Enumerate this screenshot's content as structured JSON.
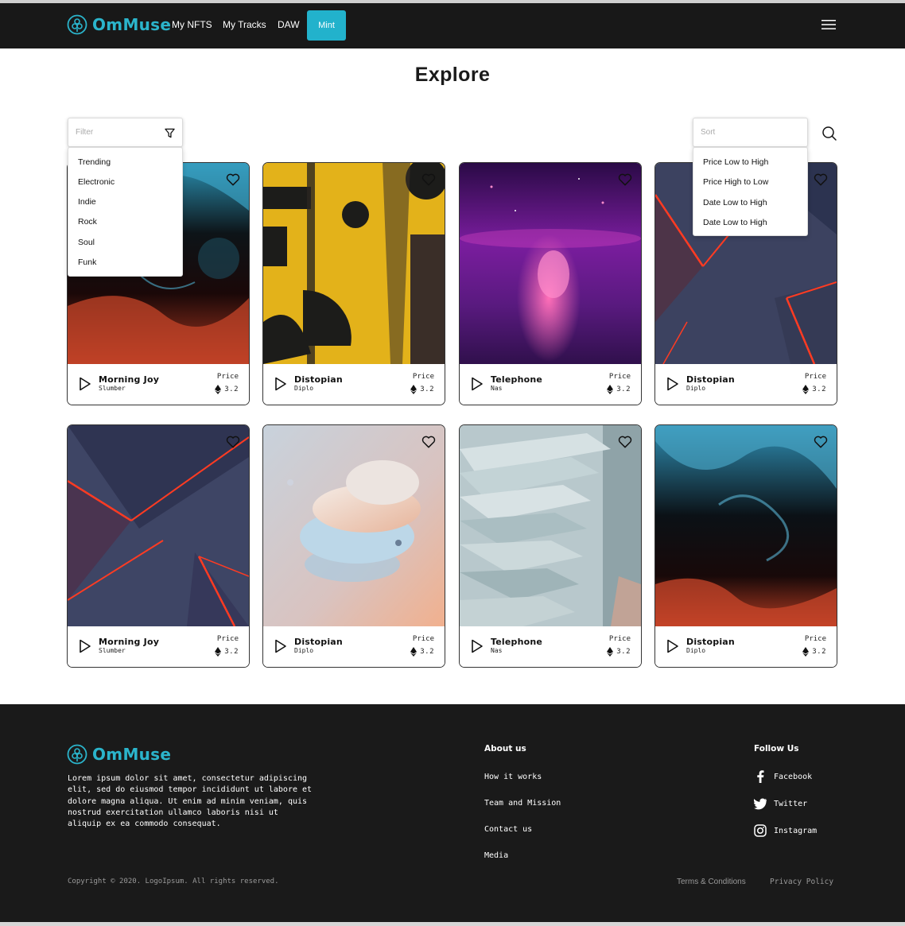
{
  "brand": {
    "name": "OmMuse",
    "accent": "#22b2cc",
    "dark": "#181818"
  },
  "nav": {
    "links": [
      "My NFTS",
      "My Tracks",
      "DAW"
    ],
    "mint": "Mint",
    "menu_icon": "hamburger-icon"
  },
  "page_title": "Explore",
  "filter": {
    "placeholder": "Filter",
    "icon": "filter-icon",
    "options": [
      "Trending",
      "Electronic",
      "Indie",
      "Rock",
      "Soul",
      "Funk"
    ]
  },
  "sort": {
    "placeholder": "Sort",
    "options": [
      "Price Low to High",
      "Price High to Low",
      "Date Low to High",
      "Date Low to High"
    ]
  },
  "search_icon": "search-icon",
  "cards": [
    {
      "title": "Morning Joy",
      "artist": "Slumber",
      "price_label": "Price",
      "price": "3.2",
      "art": "fluid-red-blue"
    },
    {
      "title": "Distopian",
      "artist": "Diplo",
      "price_label": "Price",
      "price": "3.2",
      "art": "yellow-grunge"
    },
    {
      "title": "Telephone",
      "artist": "Nas",
      "price_label": "Price",
      "price": "3.2",
      "art": "purple-galaxy"
    },
    {
      "title": "Distopian",
      "artist": "Diplo",
      "price_label": "Price",
      "price": "3.2",
      "art": "red-neon-facets"
    },
    {
      "title": "Morning Joy",
      "artist": "Slumber",
      "price_label": "Price",
      "price": "3.2",
      "art": "red-neon-facets"
    },
    {
      "title": "Distopian",
      "artist": "Diplo",
      "price_label": "Price",
      "price": "3.2",
      "art": "pastel-discs"
    },
    {
      "title": "Telephone",
      "artist": "Nas",
      "price_label": "Price",
      "price": "3.2",
      "art": "teal-stairs"
    },
    {
      "title": "Distopian",
      "artist": "Diplo",
      "price_label": "Price",
      "price": "3.2",
      "art": "fluid-red-blue"
    }
  ],
  "footer": {
    "brand": "OmMuse",
    "description": "Lorem ipsum dolor sit amet, consectetur adipiscing elit, sed do eiusmod tempor incididunt ut labore et dolore magna aliqua. Ut enim ad minim veniam, quis nostrud exercitation ullamco laboris nisi ut aliquip ex ea commodo consequat.",
    "about": {
      "heading": "About us",
      "links": [
        "How it works",
        "Team and Mission",
        "Contact us",
        "Media"
      ]
    },
    "follow": {
      "heading": "Follow Us",
      "links": [
        {
          "label": "Facebook",
          "icon": "facebook-icon"
        },
        {
          "label": "Twitter",
          "icon": "twitter-icon"
        },
        {
          "label": "Instagram",
          "icon": "instagram-icon"
        }
      ]
    },
    "copyright": "Copyright © 2020. LogoIpsum. All rights reserved.",
    "terms": "Terms & Conditions",
    "privacy": "Privacy Policy"
  }
}
